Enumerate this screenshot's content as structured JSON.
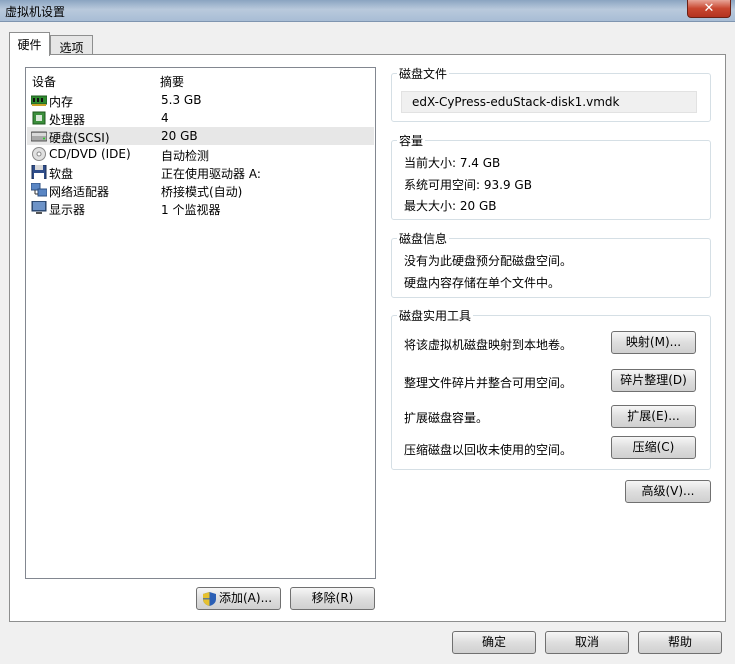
{
  "window": {
    "title": "虚拟机设置",
    "close_label": "✕"
  },
  "tabs": [
    {
      "label": "硬件",
      "active": true
    },
    {
      "label": "选项",
      "active": false
    }
  ],
  "device_list": {
    "headers": {
      "device": "设备",
      "summary": "摘要"
    },
    "rows": [
      {
        "name": "内存",
        "summary": "5.3 GB",
        "icon": "memory-icon",
        "selected": false
      },
      {
        "name": "处理器",
        "summary": "4",
        "icon": "cpu-icon",
        "selected": false
      },
      {
        "name": "硬盘(SCSI)",
        "summary": "20 GB",
        "icon": "hard-disk-icon",
        "selected": true
      },
      {
        "name": "CD/DVD (IDE)",
        "summary": "自动检测",
        "icon": "cd-dvd-icon",
        "selected": false
      },
      {
        "name": "软盘",
        "summary": "正在使用驱动器 A:",
        "icon": "floppy-icon",
        "selected": false
      },
      {
        "name": "网络适配器",
        "summary": "桥接模式(自动)",
        "icon": "network-icon",
        "selected": false
      },
      {
        "name": "显示器",
        "summary": "1 个监视器",
        "icon": "display-icon",
        "selected": false
      }
    ]
  },
  "left_buttons": {
    "add": "添加(A)...",
    "remove": "移除(R)"
  },
  "disk_file": {
    "title": "磁盘文件",
    "value": "edX-CyPress-eduStack-disk1.vmdk"
  },
  "capacity": {
    "title": "容量",
    "current": "当前大小: 7.4 GB",
    "available": "系统可用空间: 93.9 GB",
    "max": "最大大小: 20 GB"
  },
  "disk_info": {
    "title": "磁盘信息",
    "line1": "没有为此硬盘预分配磁盘空间。",
    "line2": "硬盘内容存储在单个文件中。"
  },
  "disk_utilities": {
    "title": "磁盘实用工具",
    "items": [
      {
        "desc": "将该虚拟机磁盘映射到本地卷。",
        "button": "映射(M)..."
      },
      {
        "desc": "整理文件碎片并整合可用空间。",
        "button": "碎片整理(D)"
      },
      {
        "desc": "扩展磁盘容量。",
        "button": "扩展(E)..."
      },
      {
        "desc": "压缩磁盘以回收未使用的空间。",
        "button": "压缩(C)"
      }
    ]
  },
  "advanced_button": "高级(V)...",
  "footer": {
    "ok": "确定",
    "cancel": "取消",
    "help": "帮助"
  }
}
